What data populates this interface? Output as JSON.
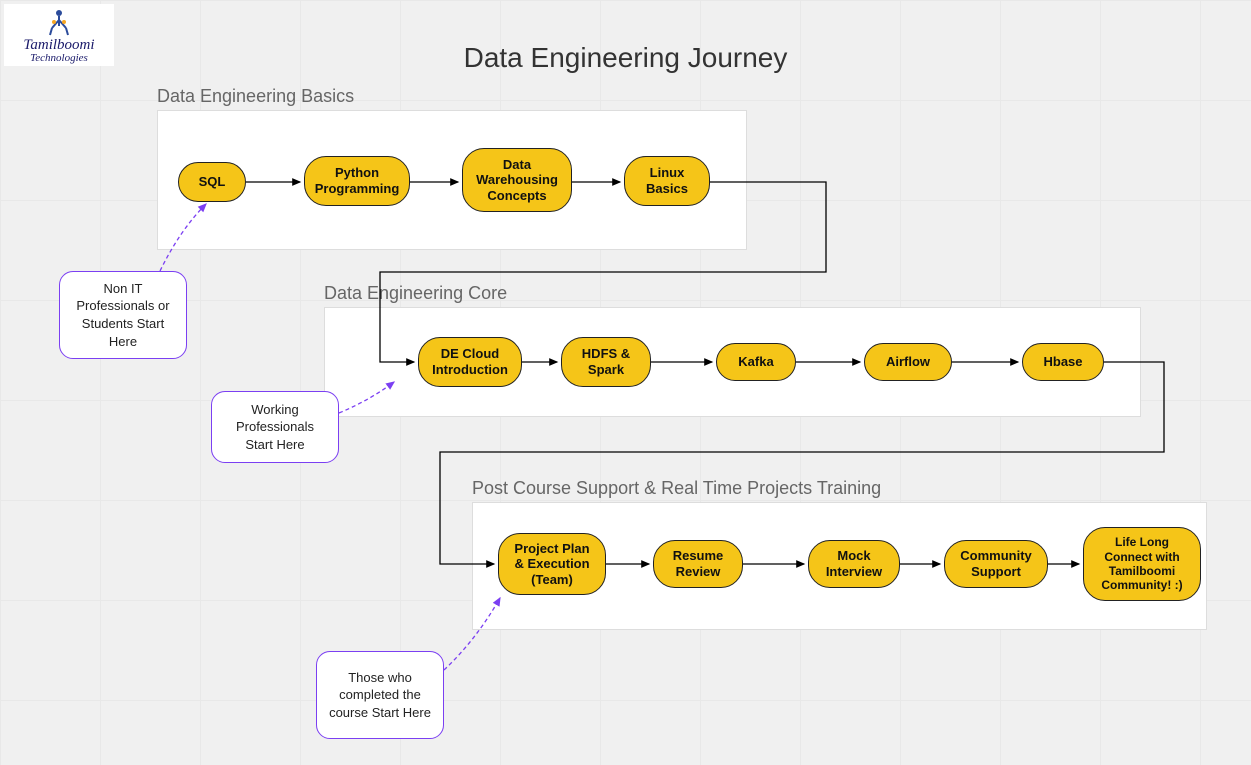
{
  "brand": {
    "name": "Tamilboomi",
    "tagline": "Technologies"
  },
  "title": "Data Engineering Journey",
  "stages": {
    "basics": {
      "label": "Data Engineering Basics",
      "nodes": [
        "SQL",
        "Python Programming",
        "Data Warehousing Concepts",
        "Linux Basics"
      ]
    },
    "core": {
      "label": "Data Engineering Core",
      "nodes": [
        "DE Cloud Introduction",
        "HDFS & Spark",
        "Kafka",
        "Airflow",
        "Hbase"
      ]
    },
    "post": {
      "label": "Post Course Support & Real Time Projects Training",
      "nodes": [
        "Project Plan & Execution (Team)",
        "Resume Review",
        "Mock Interview",
        "Community Support",
        "Life Long Connect with Tamilboomi Community! :)"
      ]
    }
  },
  "callouts": {
    "nonit": "Non IT Professionals or Students Start Here",
    "working": "Working Professionals Start Here",
    "completed": "Those who completed the course Start Here"
  }
}
